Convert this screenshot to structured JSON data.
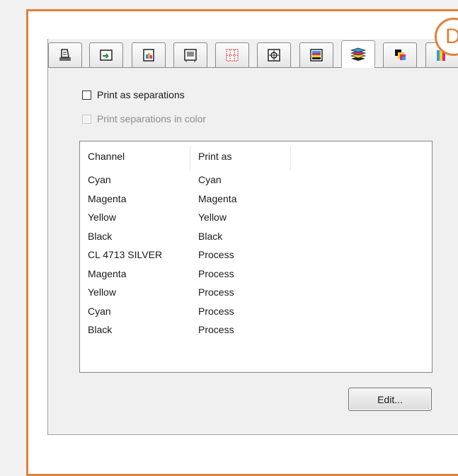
{
  "callout": {
    "label": "D",
    "color": "#e0823a"
  },
  "tabs": [
    {
      "icon": "printer-setup-icon",
      "active": false
    },
    {
      "icon": "layout-icon",
      "active": false
    },
    {
      "icon": "color-paint-icon",
      "active": false
    },
    {
      "icon": "page-frame-icon",
      "active": false
    },
    {
      "icon": "tile-grid-icon",
      "active": false
    },
    {
      "icon": "registration-marks-icon",
      "active": false
    },
    {
      "icon": "color-bars-icon",
      "active": false
    },
    {
      "icon": "separations-layers-icon",
      "active": true
    },
    {
      "icon": "cmyk-overlap-icon",
      "active": false
    },
    {
      "icon": "cmyk-bars-icon",
      "active": false
    }
  ],
  "options": {
    "print_as_separations": {
      "label": "Print as separations",
      "checked": false
    },
    "print_separations_in_color": {
      "label": "Print separations in color",
      "checked": false,
      "disabled": true
    }
  },
  "channels": {
    "headers": {
      "channel": "Channel",
      "print_as": "Print as"
    },
    "rows": [
      {
        "channel": "Cyan",
        "print_as": "Cyan"
      },
      {
        "channel": "Magenta",
        "print_as": "Magenta"
      },
      {
        "channel": "Yellow",
        "print_as": "Yellow"
      },
      {
        "channel": "Black",
        "print_as": "Black"
      },
      {
        "channel": "CL 4713 SILVER",
        "print_as": "Process"
      },
      {
        "channel": "Magenta",
        "print_as": "Process"
      },
      {
        "channel": "Yellow",
        "print_as": "Process"
      },
      {
        "channel": "Cyan",
        "print_as": "Process"
      },
      {
        "channel": "Black",
        "print_as": "Process"
      }
    ]
  },
  "edit_button": {
    "label": "Edit..."
  }
}
